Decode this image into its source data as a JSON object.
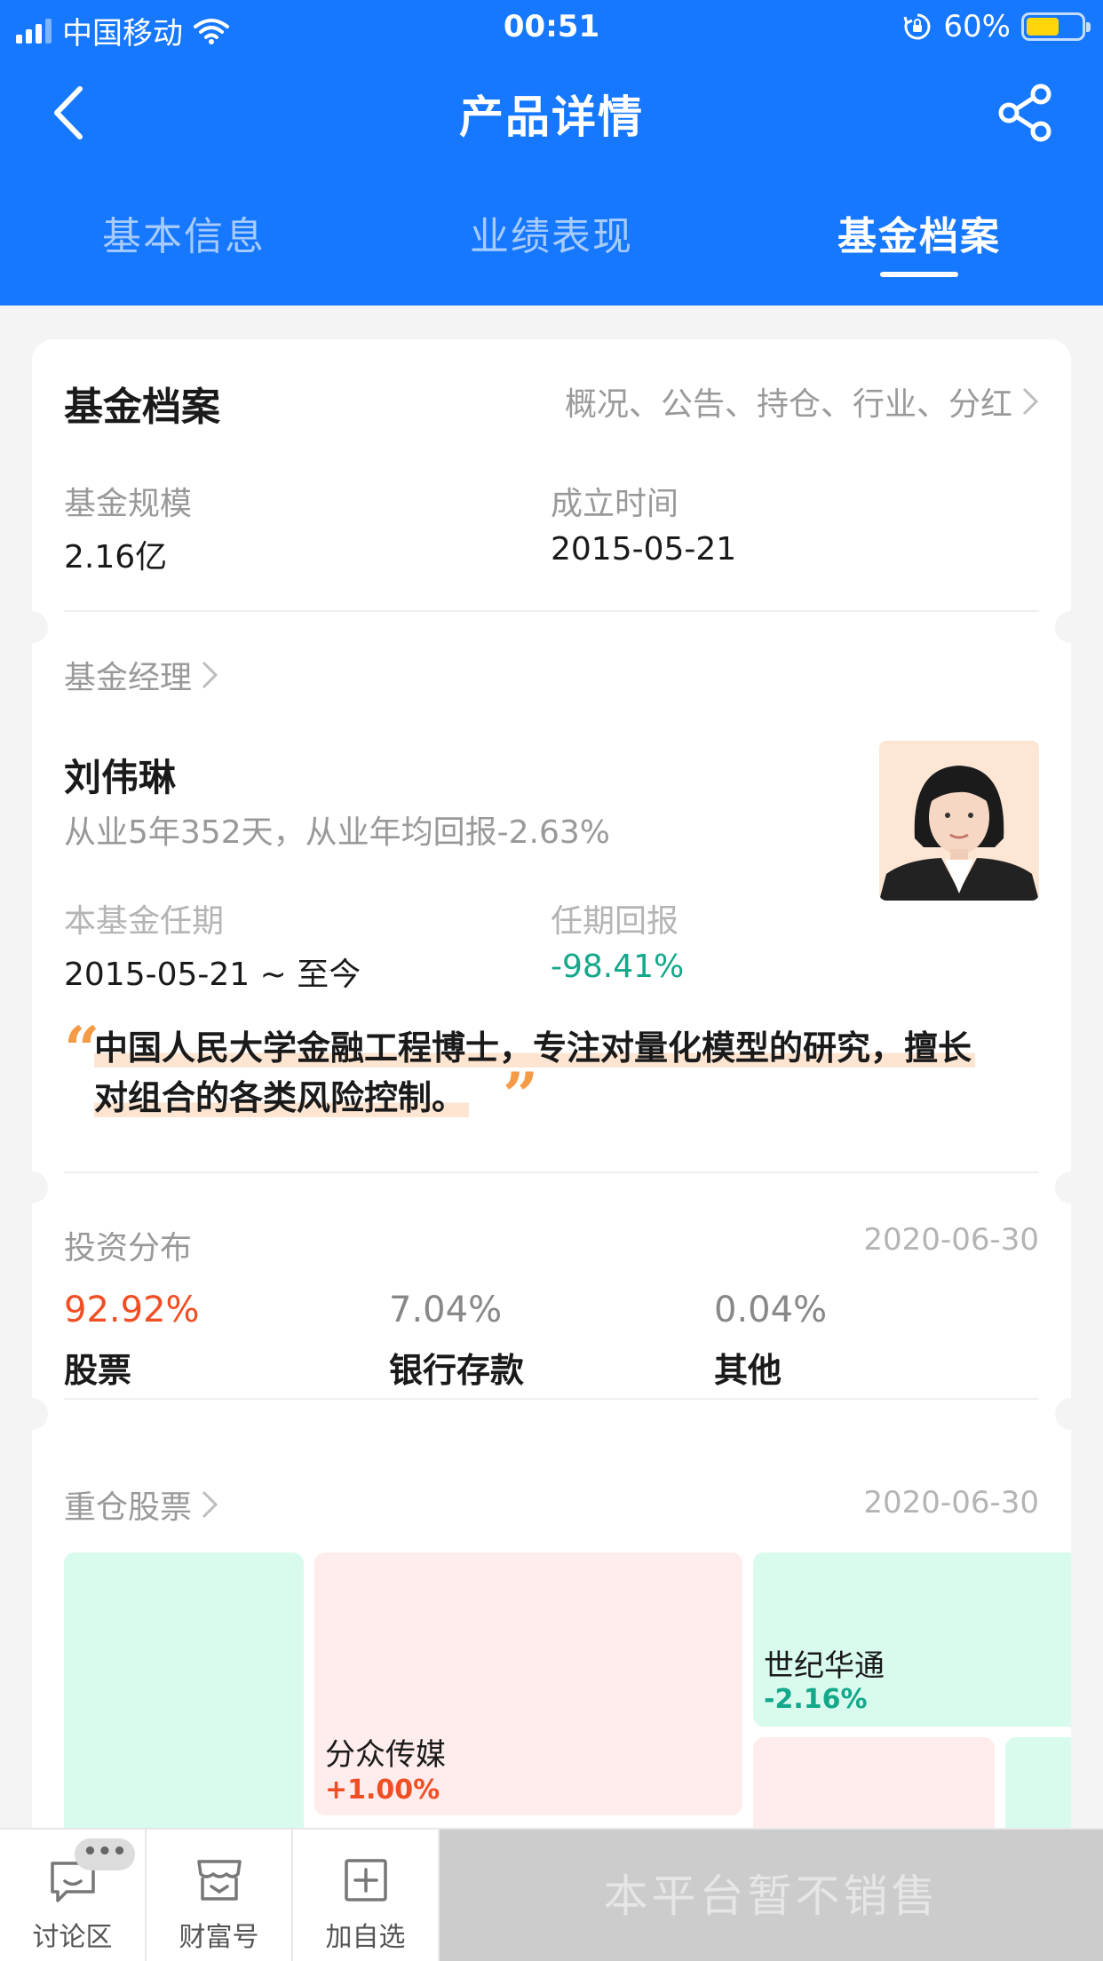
{
  "status_bar": {
    "carrier": "中国移动",
    "time": "00:51",
    "battery": "60%",
    "battery_level": 0.6
  },
  "nav": {
    "title": "产品详情",
    "back_icon": "chevron-left-icon",
    "share_icon": "share-icon"
  },
  "tabs": [
    {
      "label": "基本信息",
      "active": false
    },
    {
      "label": "业绩表现",
      "active": false
    },
    {
      "label": "基金档案",
      "active": true
    }
  ],
  "profile": {
    "title": "基金档案",
    "links": "概况、公告、持仓、行业、分红",
    "scale_label": "基金规模",
    "scale_value": "2.16亿",
    "founded_label": "成立时间",
    "founded_value": "2015-05-21"
  },
  "manager": {
    "header": "基金经理",
    "name": "刘伟琳",
    "desc": "从业5年352天，从业年均回报-2.63%",
    "tenure_label": "本基金任期",
    "tenure_value": "2015-05-21 ~ 至今",
    "return_label": "任期回报",
    "return_value": "-98.41%",
    "quote_open": "“",
    "quote_line1": "中国人民大学金融工程博士，专注对量化模型的研究，擅长",
    "quote_line2": "对组合的各类风险控制。",
    "quote_close": "”"
  },
  "distribution": {
    "title": "投资分布",
    "date": "2020-06-30",
    "items": [
      {
        "pct": "92.92%",
        "label": "股票"
      },
      {
        "pct": "7.04%",
        "label": "银行存款"
      },
      {
        "pct": "0.04%",
        "label": "其他"
      }
    ]
  },
  "holdings": {
    "title": "重仓股票",
    "date": "2020-06-30",
    "items": [
      {
        "name": "分众传媒",
        "change": "+1.00%"
      },
      {
        "name": "世纪华通",
        "change": "-2.16%"
      }
    ]
  },
  "bottom_bar": {
    "discuss": "讨论区",
    "wealth": "财富号",
    "add": "加自选",
    "dots": "•••",
    "cta": "本平台暂不销售"
  },
  "colors": {
    "brand_blue": "#1677ff",
    "up_red": "#f04e23",
    "down_green": "#14a88a"
  }
}
